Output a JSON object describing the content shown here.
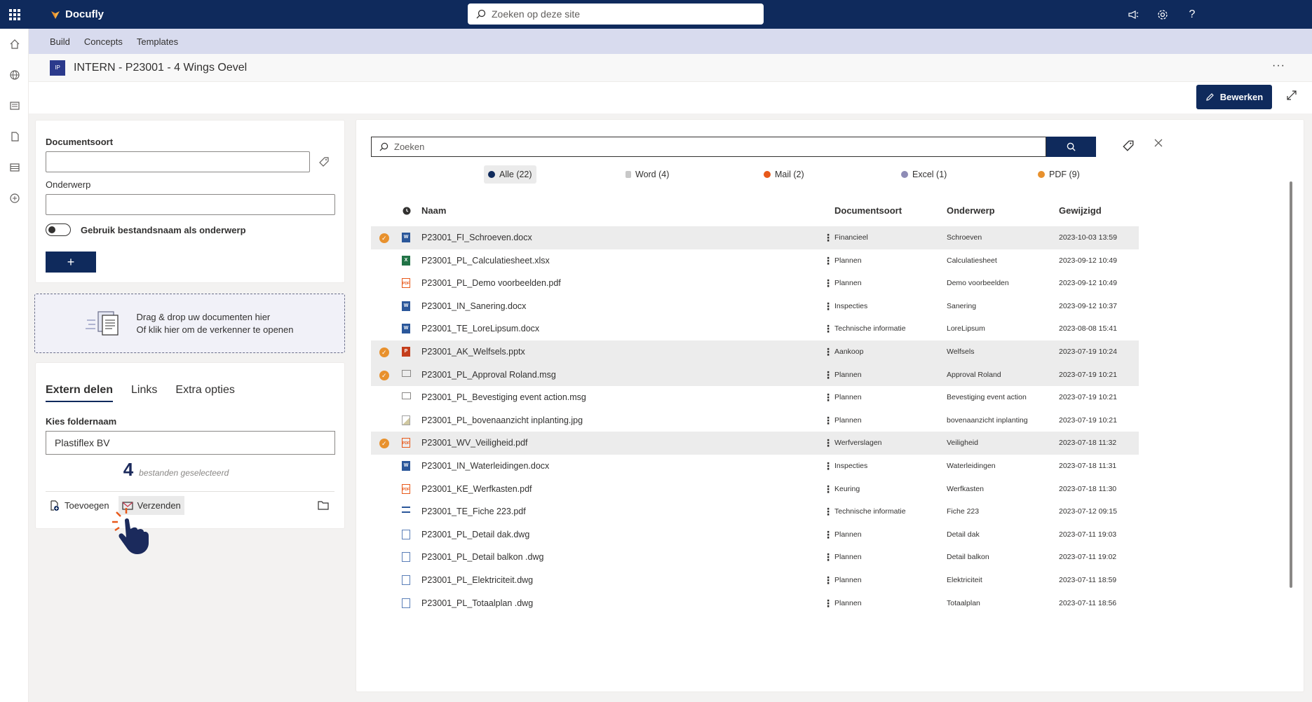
{
  "app": {
    "brand": "Docufly",
    "search_placeholder": "Zoeken op deze site",
    "help_label": "?"
  },
  "subnav": [
    "Build",
    "Concepts",
    "Templates"
  ],
  "site": {
    "logo_text": "IP",
    "title": "INTERN - P23001 - 4 Wings Oevel",
    "more": "···"
  },
  "command": {
    "edit_label": "Bewerken"
  },
  "form": {
    "doctype_label": "Documentsoort",
    "subject_label": "Onderwerp",
    "toggle_label": "Gebruik bestandsnaam als onderwerp",
    "add_label": "+"
  },
  "dropzone": {
    "line1": "Drag & drop uw documenten hier",
    "line2": "Of klik hier om de verkenner te openen"
  },
  "share": {
    "tabs": [
      "Extern delen",
      "Links",
      "Extra opties"
    ],
    "folder_label": "Kies foldernaam",
    "folder_value": "Plastiflex BV",
    "count": "4",
    "count_label": "bestanden geselecteerd",
    "add_button": "Toevoegen",
    "send_button": "Verzenden"
  },
  "library": {
    "search_placeholder": "Zoeken",
    "filters": [
      {
        "label": "Alle (22)",
        "color": "#0f2a5c"
      },
      {
        "label": "Word (4)",
        "color": "#c8c8c8"
      },
      {
        "label": "Mail (2)",
        "color": "#e8591a"
      },
      {
        "label": "Excel (1)",
        "color": "#8e8cb6"
      },
      {
        "label": "PDF (9)",
        "color": "#e8912d"
      }
    ],
    "columns": [
      "Naam",
      "Documentsoort",
      "Onderwerp",
      "Gewijzigd"
    ],
    "rows": [
      {
        "name": "P23001_FI_Schroeven.docx",
        "type": "Financieel",
        "subject": "Schroeven",
        "modified": "2023-10-03 13:59",
        "icon": "word",
        "selected": true
      },
      {
        "name": "P23001_PL_Calculatiesheet.xlsx",
        "type": "Plannen",
        "subject": "Calculatiesheet",
        "modified": "2023-09-12 10:49",
        "icon": "excel",
        "selected": false
      },
      {
        "name": "P23001_PL_Demo voorbeelden.pdf",
        "type": "Plannen",
        "subject": "Demo voorbeelden",
        "modified": "2023-09-12 10:49",
        "icon": "pdf",
        "selected": false
      },
      {
        "name": "P23001_IN_Sanering.docx",
        "type": "Inspecties",
        "subject": "Sanering",
        "modified": "2023-09-12 10:37",
        "icon": "word",
        "selected": false
      },
      {
        "name": "P23001_TE_LoreLipsum.docx",
        "type": "Technische informatie",
        "subject": "LoreLipsum",
        "modified": "2023-08-08 15:41",
        "icon": "word",
        "selected": false
      },
      {
        "name": "P23001_AK_Welfsels.pptx",
        "type": "Aankoop",
        "subject": "Welfsels",
        "modified": "2023-07-19 10:24",
        "icon": "ppt",
        "selected": true
      },
      {
        "name": "P23001_PL_Approval Roland.msg",
        "type": "Plannen",
        "subject": "Approval Roland",
        "modified": "2023-07-19 10:21",
        "icon": "mail",
        "selected": true
      },
      {
        "name": "P23001_PL_Bevestiging event action.msg",
        "type": "Plannen",
        "subject": "Bevestiging event action",
        "modified": "2023-07-19 10:21",
        "icon": "mail",
        "selected": false
      },
      {
        "name": "P23001_PL_bovenaanzicht inplanting.jpg",
        "type": "Plannen",
        "subject": "bovenaanzicht inplanting",
        "modified": "2023-07-19 10:21",
        "icon": "image",
        "selected": false
      },
      {
        "name": "P23001_WV_Veiligheid.pdf",
        "type": "Werfverslagen",
        "subject": "Veiligheid",
        "modified": "2023-07-18 11:32",
        "icon": "pdf",
        "selected": true
      },
      {
        "name": "P23001_IN_Waterleidingen.docx",
        "type": "Inspecties",
        "subject": "Waterleidingen",
        "modified": "2023-07-18 11:31",
        "icon": "word",
        "selected": false
      },
      {
        "name": "P23001_KE_Werfkasten.pdf",
        "type": "Keuring",
        "subject": "Werfkasten",
        "modified": "2023-07-18 11:30",
        "icon": "pdf",
        "selected": false
      },
      {
        "name": "P23001_TE_Fiche 223.pdf",
        "type": "Technische informatie",
        "subject": "Fiche 223",
        "modified": "2023-07-12 09:15",
        "icon": "list",
        "selected": false
      },
      {
        "name": "P23001_PL_Detail dak.dwg",
        "type": "Plannen",
        "subject": "Detail dak",
        "modified": "2023-07-11 19:03",
        "icon": "file",
        "selected": false
      },
      {
        "name": "P23001_PL_Detail balkon .dwg",
        "type": "Plannen",
        "subject": "Detail balkon",
        "modified": "2023-07-11 19:02",
        "icon": "file",
        "selected": false
      },
      {
        "name": "P23001_PL_Elektriciteit.dwg",
        "type": "Plannen",
        "subject": "Elektriciteit",
        "modified": "2023-07-11 18:59",
        "icon": "file",
        "selected": false
      },
      {
        "name": "P23001_PL_Totaalplan .dwg",
        "type": "Plannen",
        "subject": "Totaalplan",
        "modified": "2023-07-11 18:56",
        "icon": "file",
        "selected": false
      }
    ]
  }
}
